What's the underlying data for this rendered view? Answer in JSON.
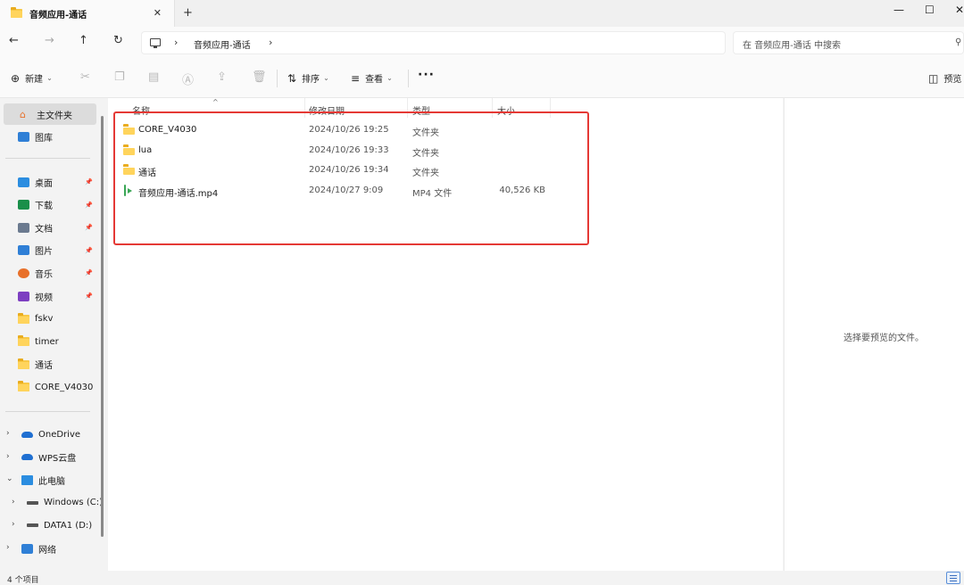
{
  "window": {
    "tab_title": "音频应用-通话",
    "tab_close": "✕",
    "new_tab": "+",
    "minimize": "—",
    "maximize": "☐",
    "close": "✕"
  },
  "nav": {
    "back": "←",
    "forward": "→",
    "up": "↑",
    "refresh": "↻",
    "address_path": "音频应用-通话",
    "search_placeholder": "在 音频应用-通话 中搜索"
  },
  "toolbar": {
    "new_label": "新建",
    "sort_label": "排序",
    "view_label": "查看",
    "more": "···",
    "preview_label": "预览"
  },
  "sidebar": {
    "home": "主文件夹",
    "gallery": "图库",
    "quick": [
      {
        "label": "桌面",
        "icon": "desktop-icon",
        "color": "#2b8de0",
        "pinned": true
      },
      {
        "label": "下载",
        "icon": "download-icon",
        "color": "#1a8f4a",
        "pinned": true
      },
      {
        "label": "文档",
        "icon": "document-icon",
        "color": "#6b7a8f",
        "pinned": true
      },
      {
        "label": "图片",
        "icon": "picture-icon",
        "color": "#2f7fd6",
        "pinned": true
      },
      {
        "label": "音乐",
        "icon": "music-icon",
        "color": "#e8702a",
        "pinned": true
      },
      {
        "label": "视频",
        "icon": "video-icon",
        "color": "#7d3fc1",
        "pinned": true
      },
      {
        "label": "fskv",
        "icon": "folder-icon",
        "color": "#f8c845",
        "pinned": false
      },
      {
        "label": "timer",
        "icon": "folder-icon",
        "color": "#f8c845",
        "pinned": false
      },
      {
        "label": "通话",
        "icon": "folder-icon",
        "color": "#f8c845",
        "pinned": false
      },
      {
        "label": "CORE_V4030",
        "icon": "folder-icon",
        "color": "#f8c845",
        "pinned": false
      }
    ],
    "locations": [
      {
        "label": "OneDrive",
        "icon": "cloud-icon",
        "expanded": false
      },
      {
        "label": "WPS云盘",
        "icon": "cloud-icon",
        "expanded": false
      },
      {
        "label": "此电脑",
        "icon": "computer-icon",
        "expanded": true
      },
      {
        "label": "Windows (C:)",
        "icon": "drive-icon",
        "expanded": false
      },
      {
        "label": "DATA1 (D:)",
        "icon": "drive-icon",
        "expanded": false
      },
      {
        "label": "网络",
        "icon": "network-icon",
        "expanded": false
      }
    ]
  },
  "columns": {
    "name": "名称",
    "date": "修改日期",
    "type": "类型",
    "size": "大小"
  },
  "files": [
    {
      "name": "CORE_V4030",
      "date": "2024/10/26 19:25",
      "type": "文件夹",
      "size": "",
      "icon": "folder-icon"
    },
    {
      "name": "lua",
      "date": "2024/10/26 19:33",
      "type": "文件夹",
      "size": "",
      "icon": "folder-icon"
    },
    {
      "name": "通话",
      "date": "2024/10/26 19:34",
      "type": "文件夹",
      "size": "",
      "icon": "folder-icon"
    },
    {
      "name": "音频应用-通话.mp4",
      "date": "2024/10/27 9:09",
      "type": "MP4 文件",
      "size": "40,526 KB",
      "icon": "video-file-icon"
    }
  ],
  "preview": {
    "empty_text": "选择要预览的文件。"
  },
  "status": {
    "item_count": "4 个项目"
  },
  "colors": {
    "highlight": "#e53935",
    "folder": "#f8c845",
    "accent": "#3b6fbf"
  }
}
